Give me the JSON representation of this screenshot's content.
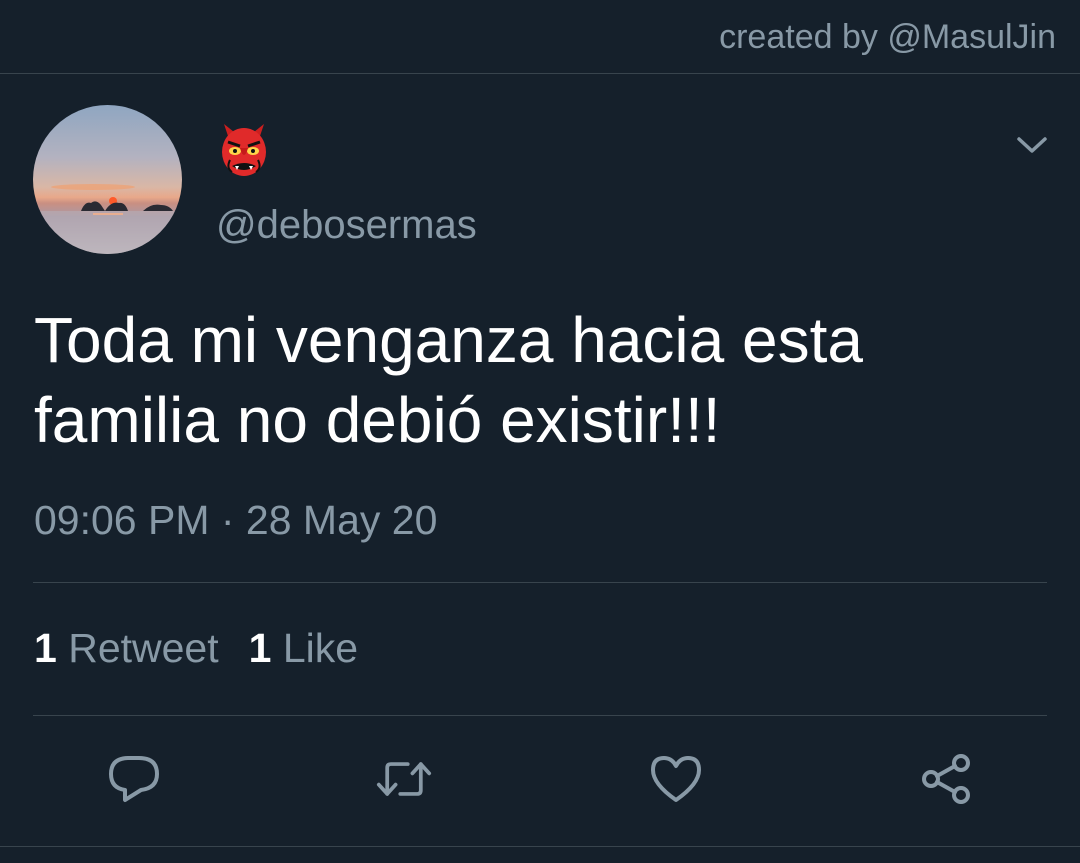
{
  "header": {
    "credit": "created by @MasulJin"
  },
  "tweet": {
    "name_emoji": "japanese-goblin-emoji",
    "handle": "@debosermas",
    "text": "Toda mi venganza hacia esta familia no debió existir!!!",
    "timestamp": "09:06 PM · 28 May 20",
    "retweets": {
      "count": "1",
      "label": "Retweet"
    },
    "likes": {
      "count": "1",
      "label": "Like"
    }
  },
  "actions": [
    {
      "icon": "reply-icon"
    },
    {
      "icon": "retweet-icon"
    },
    {
      "icon": "like-icon"
    },
    {
      "icon": "share-icon"
    }
  ],
  "colors": {
    "background": "#15202b",
    "secondary_text": "#8899a6",
    "divider": "#38444d",
    "primary_text": "#ffffff"
  }
}
